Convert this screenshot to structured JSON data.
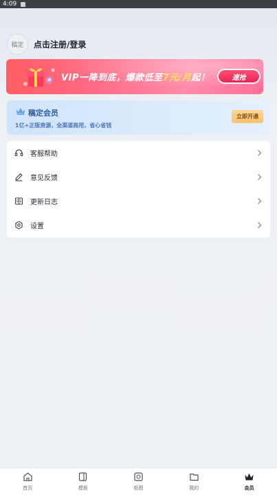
{
  "status_bar": {
    "time": "4:09"
  },
  "profile": {
    "avatar_text": "稿定",
    "login_label": "点击注册/登录"
  },
  "promo_banner": {
    "text_prefix": "VIP一降到底，爆款低至",
    "text_highlight": "7元/月",
    "text_suffix": "起！",
    "button_label": "速抢"
  },
  "vip_card": {
    "title": "稿定会员",
    "description": "1亿+正版资源，全渠道商用，省心省钱",
    "button_label": "立即开通"
  },
  "menu": {
    "items": [
      {
        "label": "客服帮助",
        "icon": "headset-icon"
      },
      {
        "label": "意见反馈",
        "icon": "pen-icon"
      },
      {
        "label": "更新日志",
        "icon": "book-icon"
      },
      {
        "label": "设置",
        "icon": "settings-icon"
      }
    ]
  },
  "tabbar": {
    "tabs": [
      {
        "label": "首页",
        "icon": "home-icon"
      },
      {
        "label": "模板",
        "icon": "template-icon"
      },
      {
        "label": "抠图",
        "icon": "cutout-icon"
      },
      {
        "label": "我的",
        "icon": "folder-icon"
      },
      {
        "label": "会员",
        "icon": "crown-icon",
        "active": true
      }
    ]
  },
  "colors": {
    "accent_blue": "#2f5ea5",
    "promo_pink": "#ff6b86",
    "promo_highlight": "#ffe55c",
    "vip_button": "#f9c16c"
  }
}
